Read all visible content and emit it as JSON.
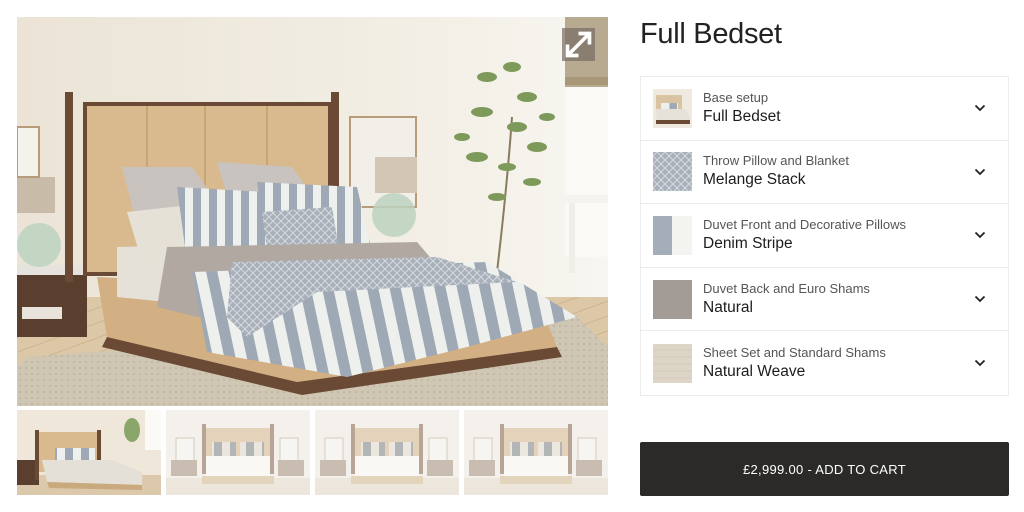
{
  "gallery": {
    "main_image_alt": "Bed with striped duvet, throw blanket, pillows, nightstands and plant in a bright bedroom",
    "expand_icon": "expand-arrows-icon",
    "thumbnails": [
      {
        "alt": "Angled view of bed with base setup",
        "selected": true
      },
      {
        "alt": "Front view of bed with nightstands"
      },
      {
        "alt": "Front view of bed with nightstands"
      },
      {
        "alt": "Front view of bed with nightstands"
      }
    ]
  },
  "product": {
    "title": "Full Bedset",
    "options": [
      {
        "label": "Base setup",
        "value": "Full Bedset",
        "swatch": "bed-thumbnail"
      },
      {
        "label": "Throw Pillow and Blanket",
        "value": "Melange Stack",
        "swatch": "diamond-knit",
        "color": "#9aa3ae"
      },
      {
        "label": "Duvet Front and Decorative Pillows",
        "value": "Denim Stripe",
        "swatch": "stripe",
        "color": "#a4adb8"
      },
      {
        "label": "Duvet Back and Euro Shams",
        "value": "Natural",
        "swatch": "solid",
        "color": "#a39b95"
      },
      {
        "label": "Sheet Set and Standard Shams",
        "value": "Natural Weave",
        "swatch": "weave",
        "color": "#ddd6c8"
      }
    ],
    "chevron_icon": "chevron-down-icon",
    "add_to_cart_label": "£2,999.00 - ADD TO CART"
  },
  "colors": {
    "button_bg": "#2b2a28",
    "button_text": "#ffffff",
    "border": "#ececec"
  }
}
